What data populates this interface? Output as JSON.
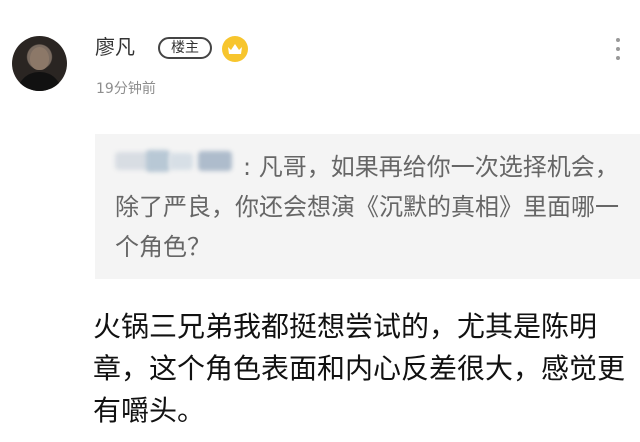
{
  "post": {
    "author": "廖凡",
    "badge": "楼主",
    "timestamp": "19分钟前"
  },
  "quote": {
    "text": ": 凡哥，如果再给你一次选择机会，除了严良，你还会想演《沉默的真相》里面哪一个角色？"
  },
  "reply": {
    "text": "火锅三兄弟我都挺想尝试的，尤其是陈明章，这个角色表面和内心反差很大，感觉更有嚼头。"
  },
  "colors": {
    "crown": "#f7c52d",
    "quote_background": "#f4f4f4"
  }
}
